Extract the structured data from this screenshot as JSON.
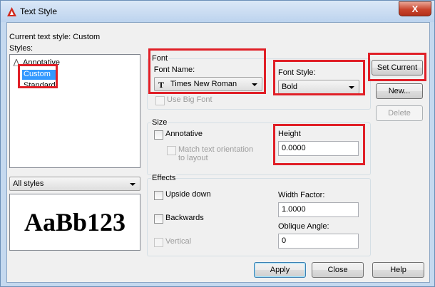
{
  "window": {
    "title": "Text Style",
    "close_glyph": "X",
    "title_icon": "autocad-triangle-icon",
    "title_icon_color": "#d22a1c"
  },
  "current_style": {
    "label": "Current text style:  Custom"
  },
  "styles": {
    "label": "Styles:",
    "items": [
      {
        "label": "Annotative",
        "icon": "annotative-icon"
      },
      {
        "label": "Custom",
        "selected": true
      },
      {
        "label": "Standard"
      }
    ],
    "filter": {
      "value": "All styles"
    }
  },
  "preview": {
    "text": "AaBb123"
  },
  "font": {
    "group_label": "Font",
    "name_label": "Font Name:",
    "name_value": "Times New Roman",
    "name_icon": "truetype-font-icon",
    "style_label": "Font Style:",
    "style_value": "Bold",
    "big_font_label": "Use Big Font"
  },
  "size": {
    "group_label": "Size",
    "annotative_label": "Annotative",
    "match_label_line1": "Match text orientation",
    "match_label_line2": "to layout",
    "height_label": "Height",
    "height_value": "0.0000"
  },
  "effects": {
    "group_label": "Effects",
    "upside_down_label": "Upside down",
    "backwards_label": "Backwards",
    "vertical_label": "Vertical",
    "width_factor_label": "Width Factor:",
    "width_factor_value": "1.0000",
    "oblique_label": "Oblique Angle:",
    "oblique_value": "0"
  },
  "buttons": {
    "set_current": "Set Current",
    "new": "New...",
    "delete": "Delete",
    "apply": "Apply",
    "close": "Close",
    "help": "Help"
  },
  "colors": {
    "highlight_outline": "#e01f27",
    "selection": "#3399ff"
  }
}
